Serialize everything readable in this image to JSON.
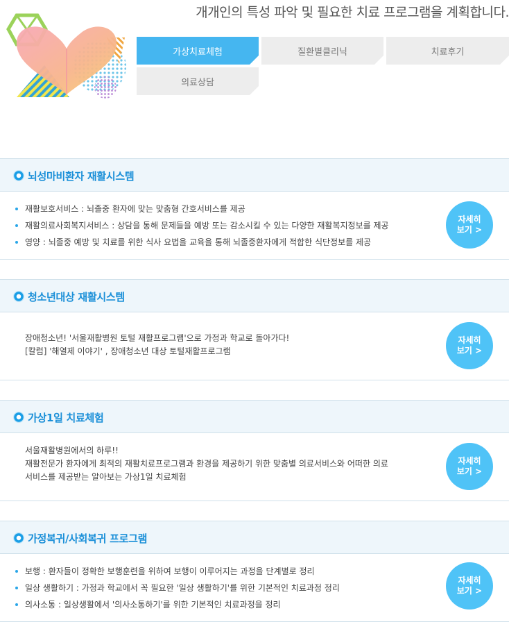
{
  "header": {
    "headline": "개개인의 특성 파악 및 필요한 치료 프로그램을 계획합니다."
  },
  "tabs": [
    {
      "label": "가상치료체험",
      "active": true
    },
    {
      "label": "질환별클리닉",
      "active": false
    },
    {
      "label": "치료후기",
      "active": false
    },
    {
      "label": "의료상담",
      "active": false
    }
  ],
  "sections": [
    {
      "title": "뇌성마비환자 재활시스템",
      "items": [
        "재활보호서비스 : 뇌졸중 환자에 맞는 맞춤형 간호서비스를 제공",
        "재활의료사회복지서비스 : 상담을 통해 문제들을 예방 또는 감소시킬 수 있는 다양한 재활복지정보를 제공",
        "영양 : 뇌졸중 예방 및 치료를 위한 식사 요법을 교육을 통해 뇌졸중환자에게 적합한 식단정보를 제공"
      ],
      "button": {
        "line1": "자세히",
        "line2": "보기 >"
      }
    },
    {
      "title": "청소년대상 재활시스템",
      "lines": [
        "장애청소년! '서울재활병원 토털 재활프로그램'으로 가정과 학교로 돌아가다!",
        "[칼럼] '해열제 이야기' , 장애청소년 대상 토털재활프로그램"
      ],
      "button": {
        "line1": "자세히",
        "line2": "보기 >"
      }
    },
    {
      "title": "가상1일 치료체험",
      "lines": [
        "서울재활병원에서의 하루!!",
        "재활전문가 환자에게 최적의 재활치료프로그램과 환경을 제공하기 위한 맞춤별 의료서비스와 어떠한 의료",
        "서비스를 제공받는 알아보는 가상1일 치료체험"
      ],
      "button": {
        "line1": "자세히",
        "line2": "보기 >"
      }
    },
    {
      "title": "가정복귀/사회복귀 프로그램",
      "items": [
        "보행 : 환자들이 정확한 보행훈련을 위하여 보행이 이루어지는 과정을 단계별로 정리",
        "일상 생활하기 : 가정과 학교에서 꼭 필요한 '일상 생활하기'를 위한 기본적인 치료과정 정리",
        "의사소통 :  일상생활에서 '의사소통하기'를 위한 기본적인 치료과정을 정리"
      ],
      "button": {
        "line1": "자세히",
        "line2": "보기 >"
      }
    }
  ]
}
